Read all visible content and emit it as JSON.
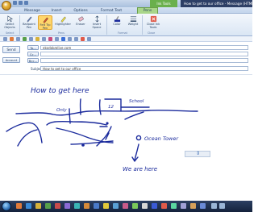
{
  "window": {
    "contextual_tab_group": "Ink Tools",
    "title": "How to get to our office - Message (HTML)"
  },
  "tabs": [
    {
      "label": "Message"
    },
    {
      "label": "Insert"
    },
    {
      "label": "Options"
    },
    {
      "label": "Format Text"
    },
    {
      "label": "Pens"
    }
  ],
  "ribbon": {
    "select_objects": "Select Objects",
    "ballpoint_pen": "Ballpoint Pen",
    "felt_tip_pen": "Felt Tip Pen",
    "highlighter": "Highlighter",
    "eraser": "Eraser",
    "insert_space": "Insert Space",
    "color": "Color",
    "weight": "Weight",
    "close_ink_tools": "Close Ink Tools",
    "group_select": "Select",
    "group_pens": "Pens",
    "group_format": "Format",
    "group_close": "Close"
  },
  "compose": {
    "send_label": "Send",
    "account_label": "Account",
    "to_label": "To...",
    "cc_label": "Cc...",
    "bcc_label": "Bcc...",
    "subject_label": "Subject:",
    "to_value": "ekodak@live.com",
    "cc_value": "",
    "bcc_value": "",
    "subject_value": "How to get to our office"
  },
  "ink": {
    "heading": "How to get here",
    "school": "School",
    "ocean_tower": "Ocean Tower",
    "we_are_here": "We are here",
    "marker_1": "12",
    "marker_2": "Only"
  },
  "colors": {
    "ink": "#1a2a9c",
    "accent_tab": "#a9d68a"
  }
}
